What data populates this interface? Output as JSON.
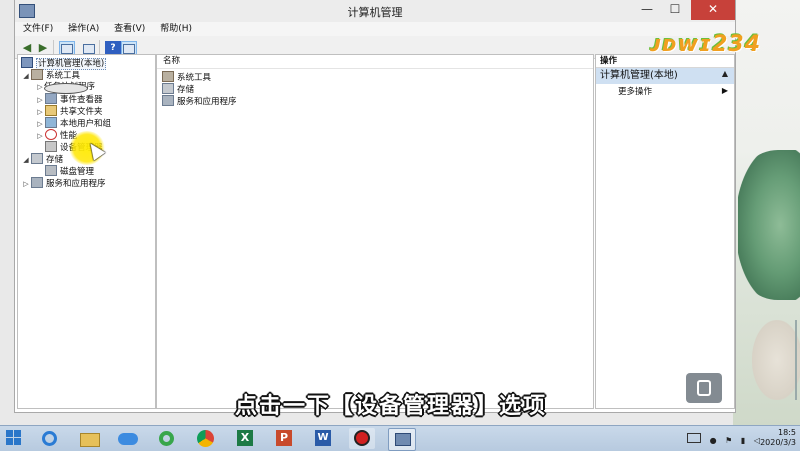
{
  "window": {
    "title": "计算机管理",
    "controls": {
      "minimize": "—",
      "maximize": "☐",
      "close": "✕"
    }
  },
  "menubar": {
    "items": [
      "文件(F)",
      "操作(A)",
      "查看(V)",
      "帮助(H)"
    ]
  },
  "toolbar": {
    "back": "◀",
    "forward": "▶",
    "help": "?"
  },
  "tree": {
    "items": [
      {
        "label": "计算机管理(本地)",
        "arrow": "",
        "icon": "computer-icon"
      },
      {
        "label": "系统工具",
        "arrow": "◢",
        "icon": "tools-icon"
      },
      {
        "label": "任务计划程序",
        "arrow": "▷",
        "icon": "clock-icon"
      },
      {
        "label": "事件查看器",
        "arrow": "▷",
        "icon": "event-viewer-icon"
      },
      {
        "label": "共享文件夹",
        "arrow": "▷",
        "icon": "shared-folder-icon"
      },
      {
        "label": "本地用户和组",
        "arrow": "▷",
        "icon": "users-icon"
      },
      {
        "label": "性能",
        "arrow": "▷",
        "icon": "performance-icon"
      },
      {
        "label": "设备管理器",
        "arrow": "",
        "icon": "device-manager-icon"
      },
      {
        "label": "存储",
        "arrow": "◢",
        "icon": "storage-icon"
      },
      {
        "label": "磁盘管理",
        "arrow": "",
        "icon": "disk-icon"
      },
      {
        "label": "服务和应用程序",
        "arrow": "▷",
        "icon": "services-icon"
      }
    ]
  },
  "list": {
    "column_header": "名称",
    "items": [
      "系统工具",
      "存储",
      "服务和应用程序"
    ]
  },
  "actions": {
    "header": "操作",
    "section_title": "计算机管理(本地)",
    "collapse": "▲",
    "items": [
      {
        "label": "更多操作",
        "arrow": "▶"
      }
    ]
  },
  "subtitle": "点击一下【设备管理器】选项",
  "watermark": "ᴊᴅᴡɪ234",
  "taskbar": {
    "time": "18:5",
    "date": "2020/3/3"
  }
}
